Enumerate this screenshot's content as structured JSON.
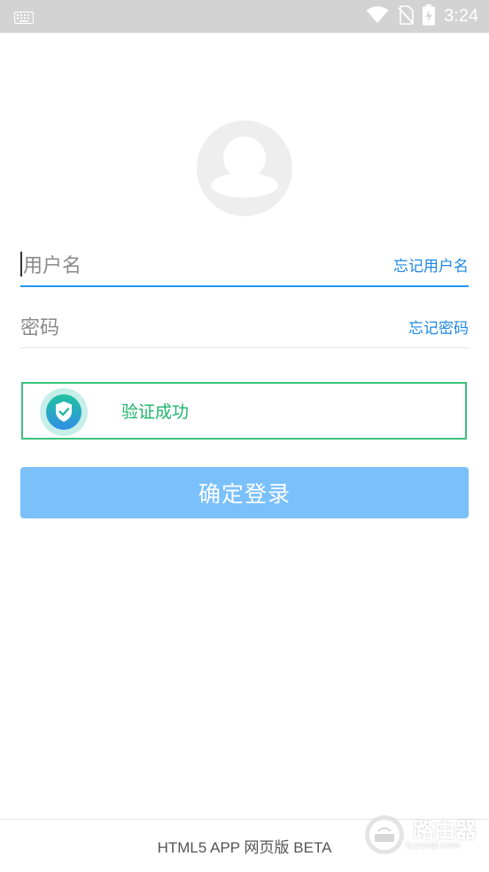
{
  "status_bar": {
    "time": "3:24",
    "icons": [
      "keyboard-icon",
      "wifi-icon",
      "no-sim-icon",
      "battery-charging-icon"
    ]
  },
  "login": {
    "username_placeholder": "用户名",
    "forgot_username": "忘记用户名",
    "password_placeholder": "密码",
    "forgot_password": "忘记密码",
    "verify_text": "验证成功",
    "submit_label": "确定登录"
  },
  "footer": {
    "text": "HTML5 APP 网页版 BETA"
  },
  "watermark": {
    "title": "路由器",
    "subtitle": "luyouqi.com"
  },
  "colors": {
    "accent": "#2196f3",
    "button": "#7ac0fb",
    "success": "#1fb36b"
  }
}
